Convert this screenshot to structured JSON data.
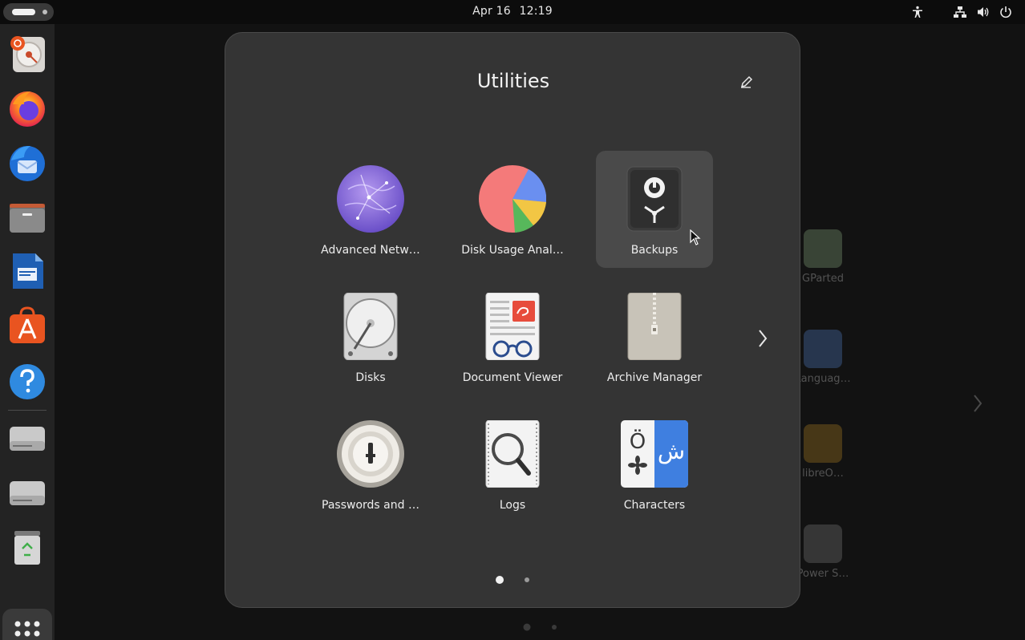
{
  "topbar": {
    "date": "Apr 16",
    "time": "12:19",
    "tray": [
      "accessibility-icon",
      "network-icon",
      "volume-icon",
      "power-icon"
    ]
  },
  "dock": {
    "items": [
      {
        "name": "disk-usage-dock-icon"
      },
      {
        "name": "firefox-icon"
      },
      {
        "name": "thunderbird-icon"
      },
      {
        "name": "files-icon"
      },
      {
        "name": "libreoffice-writer-icon"
      },
      {
        "name": "app-center-icon"
      },
      {
        "name": "help-icon"
      },
      {
        "name": "drive-1-icon"
      },
      {
        "name": "drive-2-icon"
      },
      {
        "name": "trash-icon"
      }
    ],
    "show_apps": "show-apps-icon"
  },
  "background_apps": [
    {
      "label": "GParted"
    },
    {
      "label": "Languag…"
    },
    {
      "label": "libreO…"
    },
    {
      "label": "Power S…"
    }
  ],
  "folder": {
    "title": "Utilities",
    "apps": [
      {
        "label": "Advanced Netw…",
        "icon": "advanced-network-icon"
      },
      {
        "label": "Disk Usage Anal…",
        "icon": "disk-usage-analyzer-icon"
      },
      {
        "label": "Backups",
        "icon": "backups-icon"
      },
      {
        "label": "Disks",
        "icon": "disks-icon"
      },
      {
        "label": "Document Viewer",
        "icon": "document-viewer-icon"
      },
      {
        "label": "Archive Manager",
        "icon": "archive-manager-icon"
      },
      {
        "label": "Passwords and …",
        "icon": "passwords-icon"
      },
      {
        "label": "Logs",
        "icon": "logs-icon"
      },
      {
        "label": "Characters",
        "icon": "characters-icon"
      }
    ],
    "current_page": 1,
    "page_count": 2
  },
  "colors": {
    "panel": "#343434",
    "hover": "#4a4a4a",
    "text": "#ededed"
  }
}
